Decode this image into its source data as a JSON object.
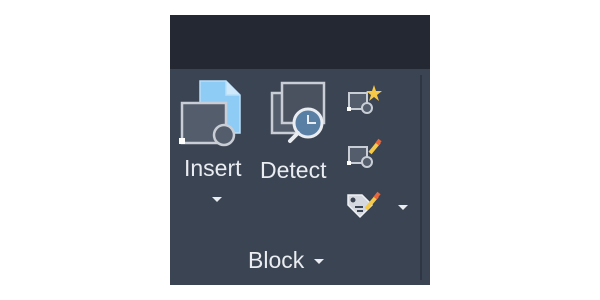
{
  "panel": {
    "title": "Block",
    "title_dropdown_icon": "caret-down-icon"
  },
  "buttons": {
    "insert": {
      "label": "Insert",
      "icon": "insert-block-icon",
      "has_dropdown": true
    },
    "detect": {
      "label": "Detect",
      "icon": "detect-block-icon"
    },
    "small": [
      {
        "icon": "create-block-icon"
      },
      {
        "icon": "edit-block-icon"
      },
      {
        "icon": "edit-attributes-icon",
        "has_dropdown": true
      }
    ]
  },
  "colors": {
    "panel_bg": "#3b4453",
    "topbar_bg": "#232833",
    "text": "#e9ecf0",
    "accent_blue": "#8ecbf5",
    "accent_yellow": "#f7c948",
    "accent_orange": "#e8663a"
  }
}
